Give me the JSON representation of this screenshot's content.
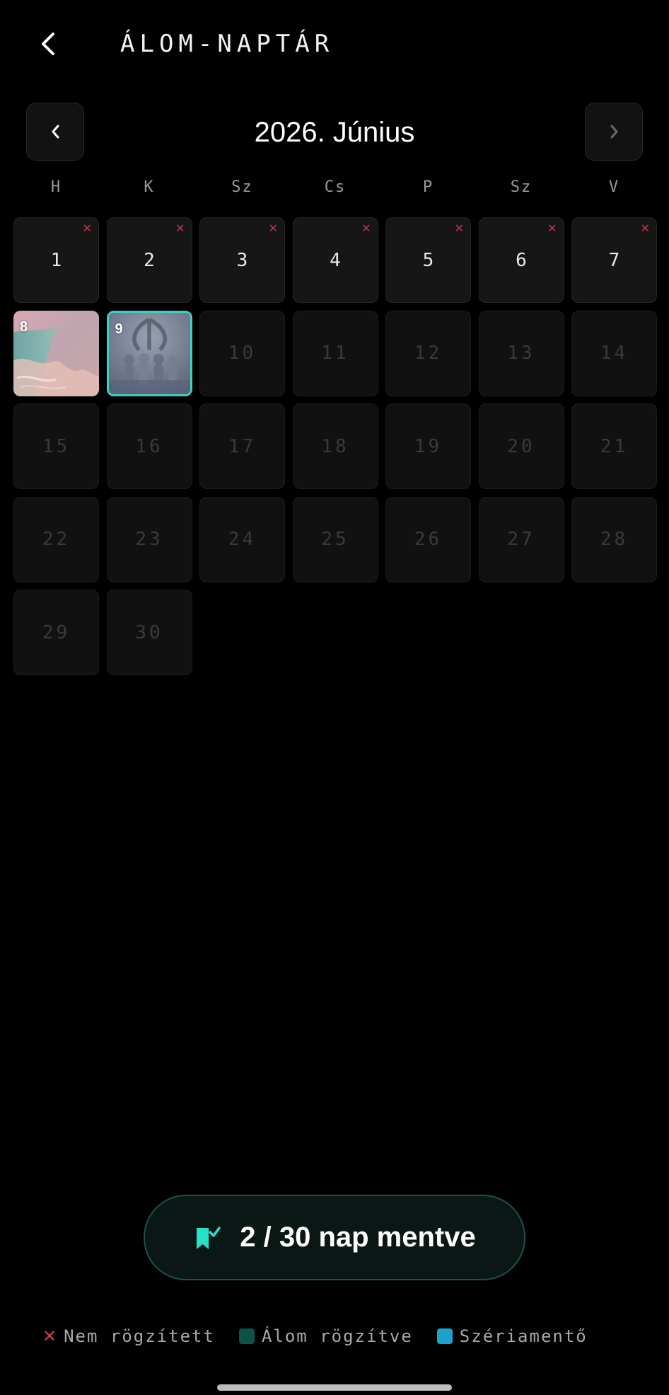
{
  "header": {
    "title": "ÁLOM-NAPTÁR",
    "back_icon": "chevron-left-icon"
  },
  "month_nav": {
    "label": "2026. Június",
    "prev_icon": "chevron-left-icon",
    "next_icon": "chevron-right-icon"
  },
  "weekdays": [
    "H",
    "K",
    "Sz",
    "Cs",
    "P",
    "Sz",
    "V"
  ],
  "days": {
    "d1": "1",
    "d2": "2",
    "d3": "3",
    "d4": "4",
    "d5": "5",
    "d6": "6",
    "d7": "7",
    "d8": "8",
    "d9": "9",
    "d10": "10",
    "d11": "11",
    "d12": "12",
    "d13": "13",
    "d14": "14",
    "d15": "15",
    "d16": "16",
    "d17": "17",
    "d18": "18",
    "d19": "19",
    "d20": "20",
    "d21": "21",
    "d22": "22",
    "d23": "23",
    "d24": "24",
    "d25": "25",
    "d26": "26",
    "d27": "27",
    "d28": "28",
    "d29": "29",
    "d30": "30",
    "missed_mark": "✕"
  },
  "summary": {
    "text": "2 / 30 nap mentve",
    "icon": "bookmark-check-icon"
  },
  "legend": {
    "missed_mark": "✕",
    "missed": "Nem rögzített",
    "recorded": "Álom rögzítve",
    "streak_saver": "Szériamentő"
  },
  "colors": {
    "accent": "#3fd0c2",
    "missed": "#d03a52",
    "recorded": "#0f5248",
    "streak_saver": "#1ba3cc"
  }
}
